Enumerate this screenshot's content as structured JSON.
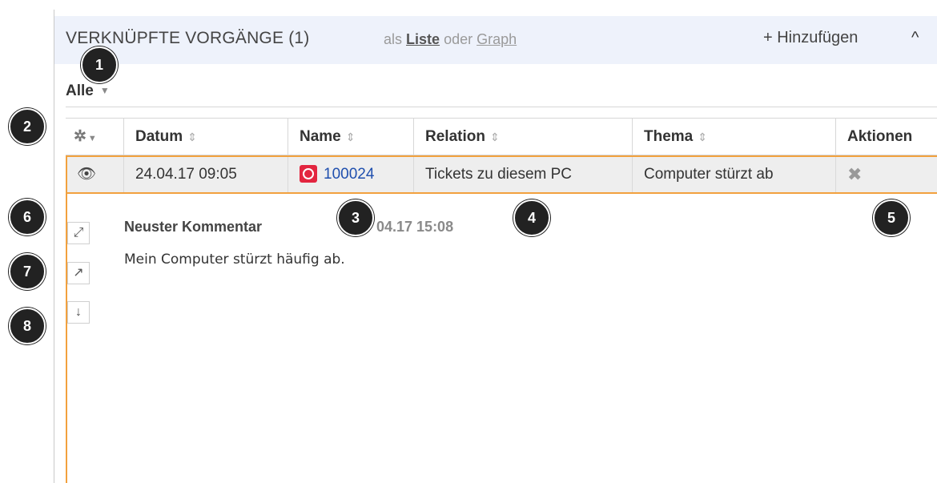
{
  "header": {
    "title": "VERKNÜPFTE VORGÄNGE (1)",
    "view_prefix": "als",
    "view_list": "Liste",
    "view_or": "oder",
    "view_graph": "Graph",
    "add_label": "+ Hinzufügen",
    "collapse_icon": "^"
  },
  "filter": {
    "label": "Alle",
    "caret": "▼"
  },
  "table": {
    "settings_icon": "✲",
    "settings_caret": "▼",
    "sort_icon": "⇕",
    "columns": [
      "Datum",
      "Name",
      "Relation",
      "Thema",
      "Aktionen"
    ],
    "rows": [
      {
        "view_icon": "👁",
        "datum": "24.04.17 09:05",
        "name": "100024",
        "relation": "Tickets zu diesem PC",
        "thema": "Computer stürzt ab",
        "action_icon": "✖"
      }
    ]
  },
  "detail": {
    "comment_title": "Neuster Kommentar",
    "comment_date": "04.17 15:08",
    "comment_text": "Mein Computer stürzt häufig ab.",
    "buttons": {
      "expand_icon": "⤢",
      "open_icon": "↗",
      "down_icon": "↓"
    }
  },
  "callouts": [
    "1",
    "2",
    "3",
    "4",
    "5",
    "6",
    "7",
    "8"
  ],
  "colors": {
    "highlight": "#f2a13e",
    "header_bg": "#eef2fb",
    "link": "#1f4fae",
    "priority": "#e3253f"
  }
}
